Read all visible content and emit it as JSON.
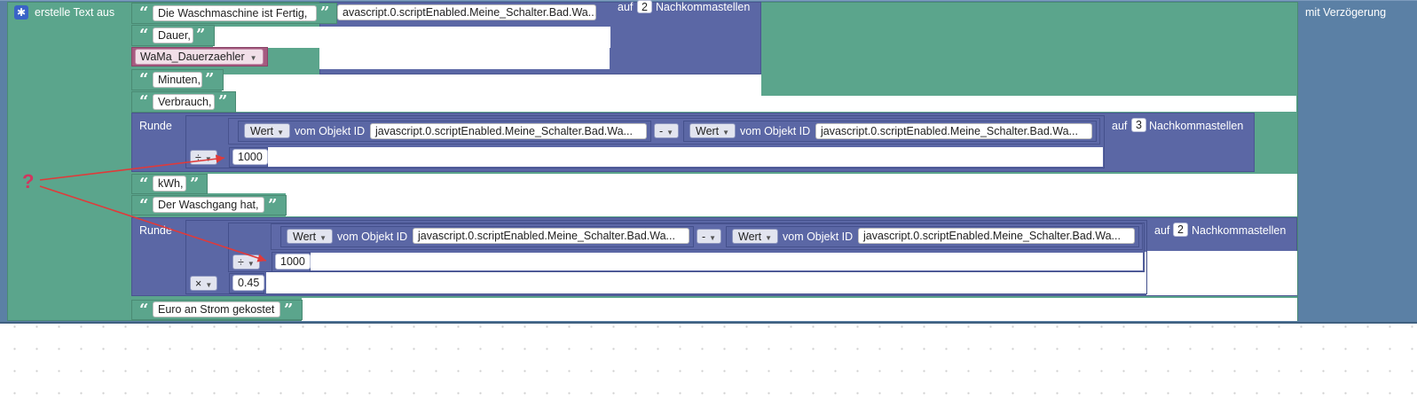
{
  "main_block": {
    "label": "erstelle Text aus",
    "right_label": "mit Verzögerung",
    "gear_icon": "gear-icon"
  },
  "rows": {
    "r1": {
      "text": "Die Waschmaschine ist Fertig,",
      "behind_field": "avascript.0.scriptEnabled.Meine_Schalter.Bad.Wa...",
      "round_prefix": "auf",
      "round_num": "2",
      "round_suffix": "Nachkommastellen"
    },
    "r2": {
      "text": "Dauer,"
    },
    "r3": {
      "variable": "WaMa_Dauerzaehler"
    },
    "r4": {
      "text": "Minuten,"
    },
    "r5": {
      "text": "Verbrauch,"
    },
    "r6": {
      "runde": "Runde",
      "left": {
        "prop": "Wert",
        "of": "vom Objekt ID",
        "id": "javascript.0.scriptEnabled.Meine_Schalter.Bad.Wa..."
      },
      "op": "-",
      "right": {
        "prop": "Wert",
        "of": "vom Objekt ID",
        "id": "javascript.0.scriptEnabled.Meine_Schalter.Bad.Wa..."
      },
      "div_op": "÷",
      "divisor": "1000",
      "round_prefix": "auf",
      "round_num": "3",
      "round_suffix": "Nachkommastellen"
    },
    "r7": {
      "text": "kWh,"
    },
    "r8": {
      "text": "Der Waschgang hat,"
    },
    "r9": {
      "runde": "Runde",
      "left": {
        "prop": "Wert",
        "of": "vom Objekt ID",
        "id": "javascript.0.scriptEnabled.Meine_Schalter.Bad.Wa..."
      },
      "op": "-",
      "right": {
        "prop": "Wert",
        "of": "vom Objekt ID",
        "id": "javascript.0.scriptEnabled.Meine_Schalter.Bad.Wa..."
      },
      "div_op": "÷",
      "divisor": "1000",
      "mul_op": "×",
      "factor": "0.45",
      "round_prefix": "auf",
      "round_num": "2",
      "round_suffix": "Nachkommastellen"
    },
    "r10": {
      "text": "Euro an Strom gekostet"
    }
  },
  "glyphs": {
    "open_quote": "“",
    "close_quote": "”",
    "dropdown_arrow": "▼"
  },
  "annotation": {
    "mark": "?",
    "arrow_color": "#e03a3a",
    "mark_color": "#d1365f"
  },
  "colors": {
    "text_block": "#5ba58c",
    "math_block": "#5b67a5",
    "outer_block": "#5b80a5",
    "variable_block": "#a55b80"
  }
}
